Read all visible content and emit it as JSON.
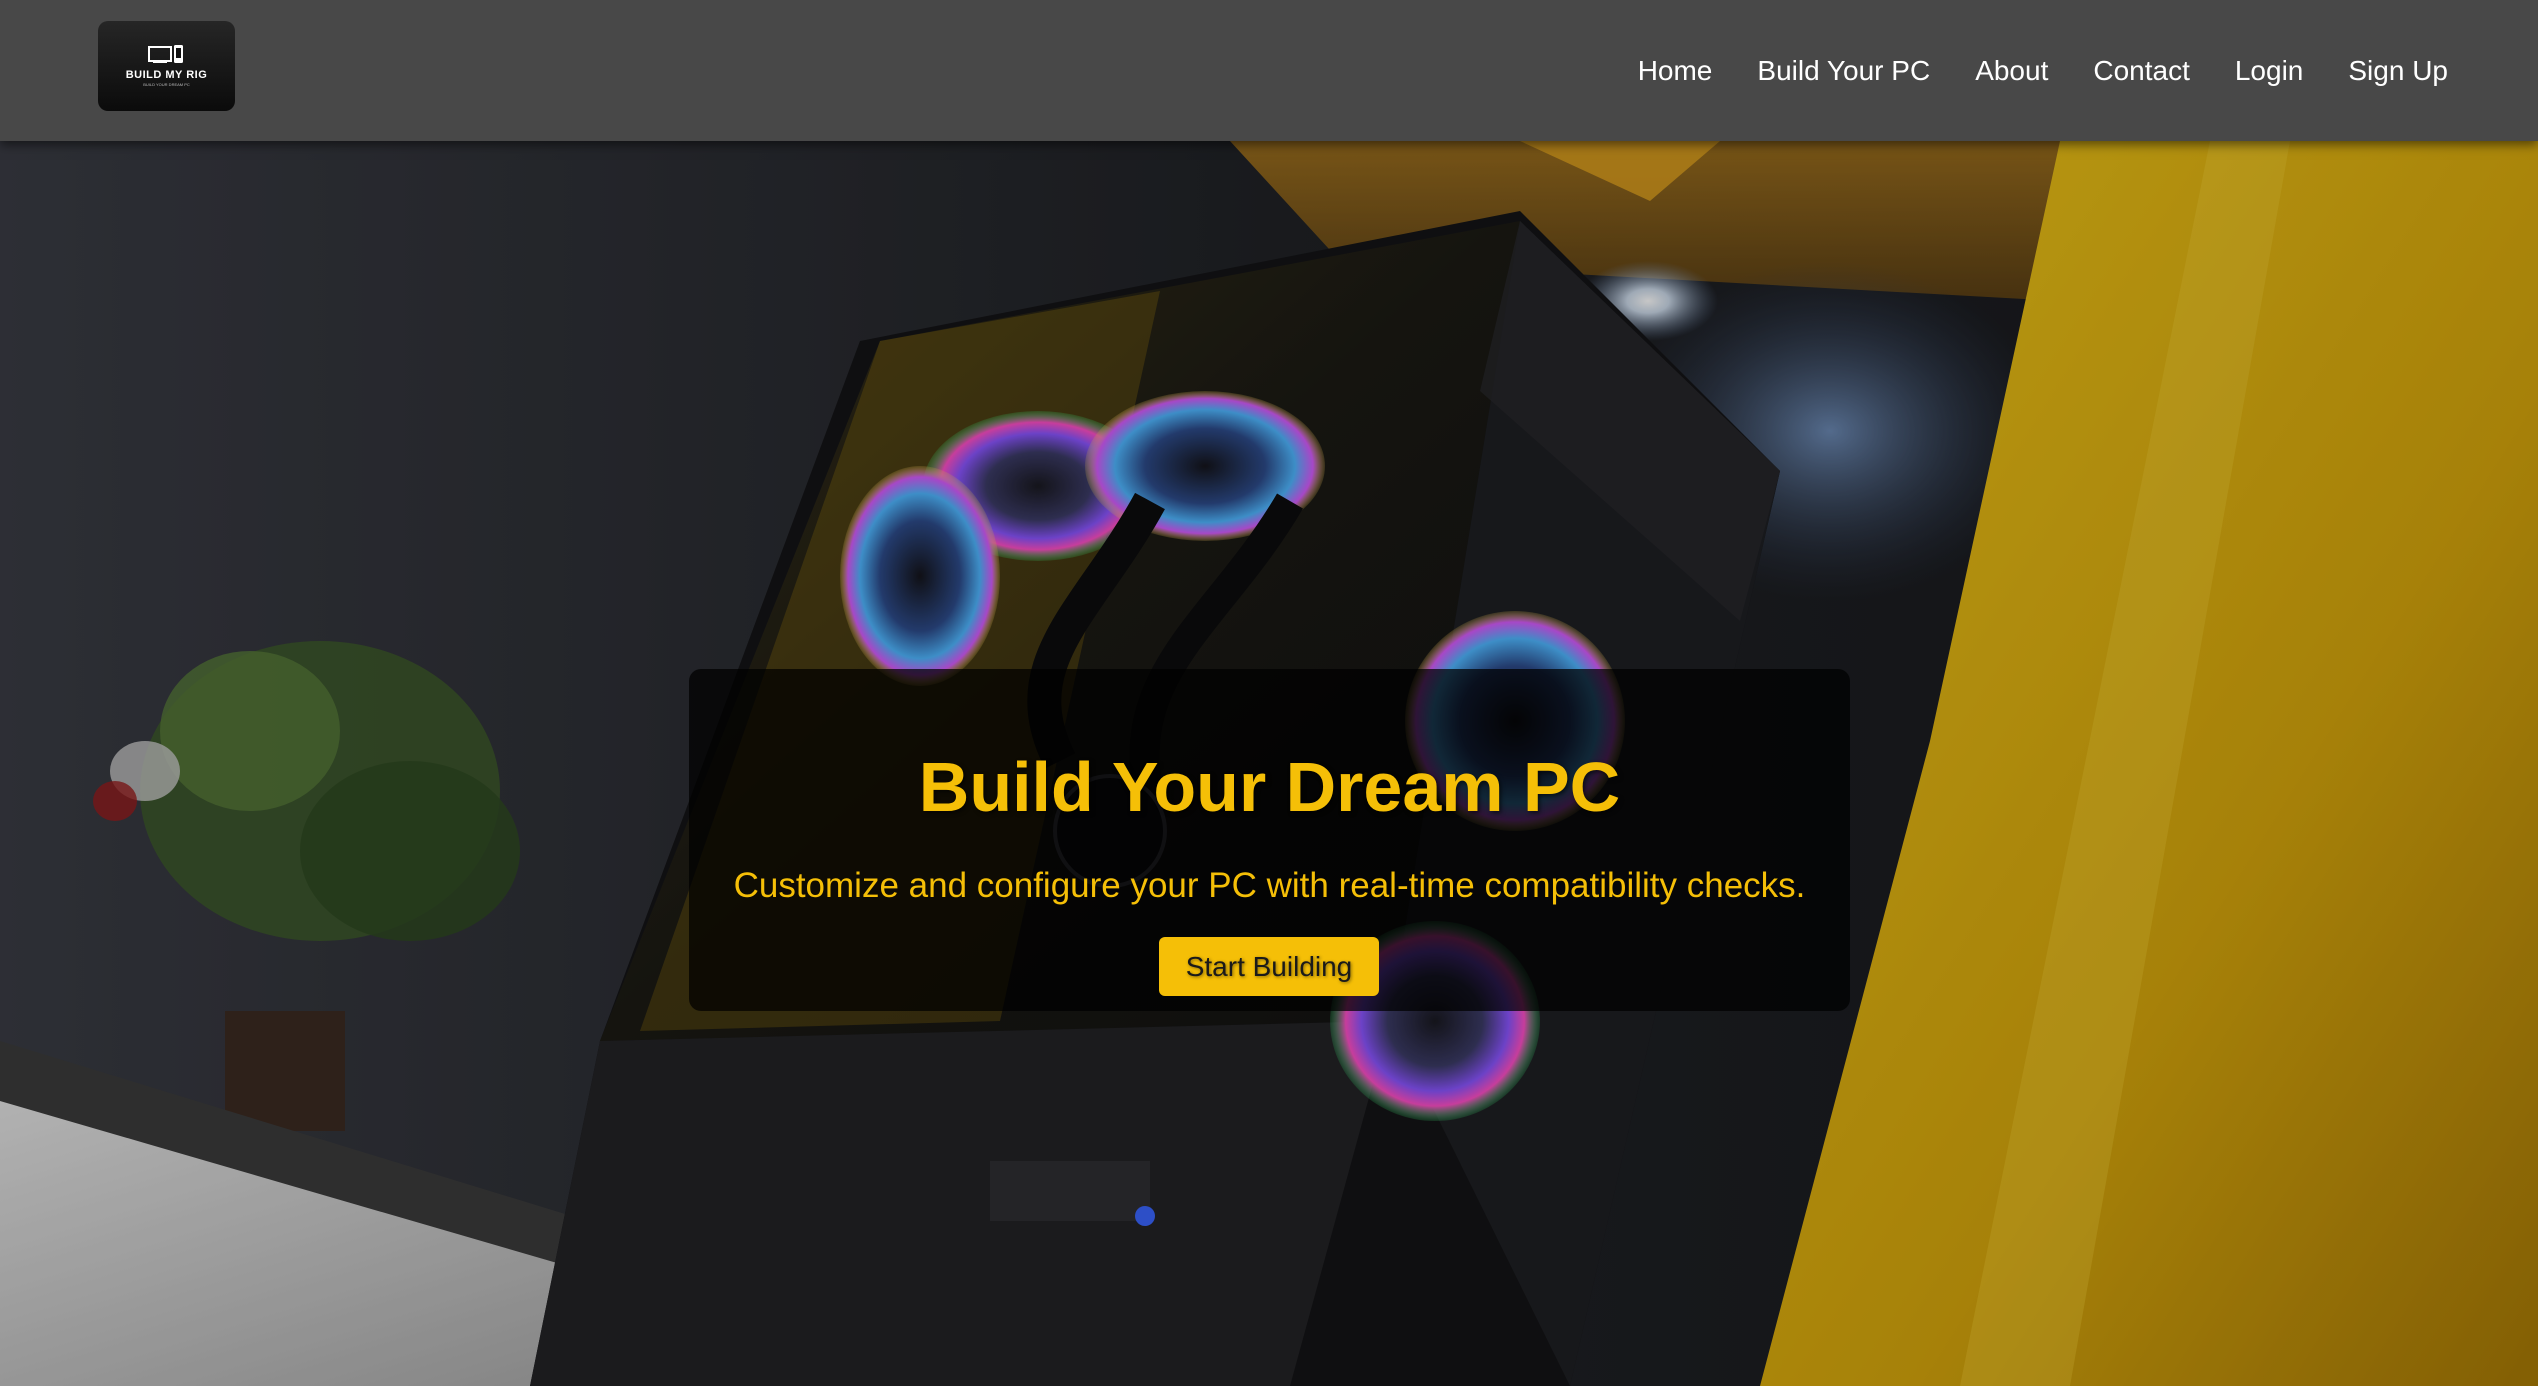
{
  "brand": {
    "logo_text": "BUILD MY RIG",
    "logo_tagline": "BUILD YOUR DREAM PC"
  },
  "nav": {
    "items": [
      {
        "label": "Home"
      },
      {
        "label": "Build Your PC"
      },
      {
        "label": "About"
      },
      {
        "label": "Contact"
      },
      {
        "label": "Login"
      },
      {
        "label": "Sign Up"
      }
    ]
  },
  "hero": {
    "title": "Build Your Dream PC",
    "subtitle": "Customize and configure your PC with real-time compatibility checks.",
    "cta_label": "Start Building"
  },
  "colors": {
    "navbar_bg": "#484848",
    "accent_yellow": "#f5bf07",
    "nav_text": "#ffffff",
    "overlay_box": "rgba(0,0,0,0.72)"
  },
  "icons": {
    "logo": "computer-phone-icon"
  }
}
